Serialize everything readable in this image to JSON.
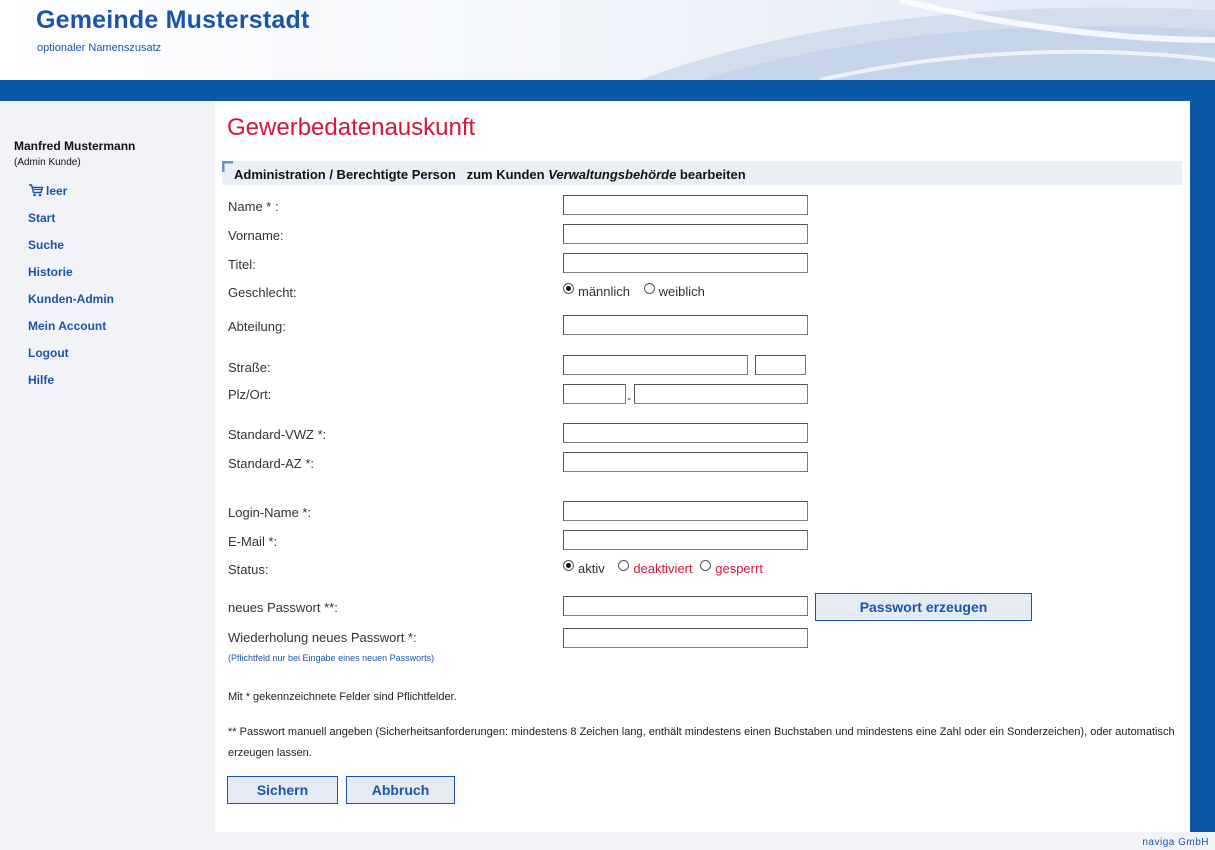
{
  "header": {
    "title": "Gemeinde Musterstadt",
    "subtitle": "optionaler Namenszusatz"
  },
  "sidebar": {
    "user_name": "Manfred Mustermann",
    "user_role": "(Admin Kunde)",
    "cart_label": "leer",
    "items": [
      {
        "label": "Start"
      },
      {
        "label": "Suche"
      },
      {
        "label": "Historie"
      },
      {
        "label": "Kunden-Admin"
      },
      {
        "label": "Mein Account"
      },
      {
        "label": "Logout"
      },
      {
        "label": "Hilfe"
      }
    ]
  },
  "main": {
    "title": "Gewerbedatenauskunft",
    "section": {
      "prefix": "Administration / Berechtigte Person   zum Kunden ",
      "customer": "Verwaltungsbehörde",
      "suffix": " bearbeiten"
    },
    "form": {
      "name_label": "Name * :",
      "vorname_label": "Vorname:",
      "titel_label": "Titel:",
      "geschlecht_label": "Geschlecht:",
      "geschlecht_options": [
        {
          "label": "männlich",
          "checked": true
        },
        {
          "label": "weiblich",
          "checked": false
        }
      ],
      "abteilung_label": "Abteilung:",
      "strasse_label": "Straße:",
      "plz_ort_label": "Plz/Ort:",
      "plz_separator": "-",
      "vwz_label": "Standard-VWZ *:",
      "az_label": "Standard-AZ *:",
      "login_label": "Login-Name *:",
      "email_label": "E-Mail *:",
      "status_label": "Status:",
      "status_options": [
        {
          "label": "aktiv",
          "checked": true,
          "color": "#333333"
        },
        {
          "label": "deaktiviert",
          "checked": false,
          "color": "#d4183a"
        },
        {
          "label": "gesperrt",
          "checked": false,
          "color": "#d4183a"
        }
      ],
      "password_label": "neues Passwort **:",
      "generate_button": "Passwort erzeugen",
      "repeat_label": "Wiederholung neues Passwort *:",
      "repeat_hint": "(Pflichtfeld nur bei Eingabe eines neuen Passworts)"
    },
    "note_required": "Mit * gekennzeichnete Felder sind Pflichtfelder.",
    "note_password": "** Passwort manuell angeben (Sicherheitsanforderungen: mindestens 8 Zeichen lang, enthält mindestens einen Buchstaben und mindestens eine Zahl oder ein Sonderzeichen), oder automatisch erzeugen lassen.",
    "save_button": "Sichern",
    "cancel_button": "Abbruch"
  },
  "footer": {
    "credit": "naviga GmbH"
  },
  "colors": {
    "brand_blue": "#1a55a8",
    "bar_blue": "#0b58a8",
    "title_red": "#d4183a"
  }
}
